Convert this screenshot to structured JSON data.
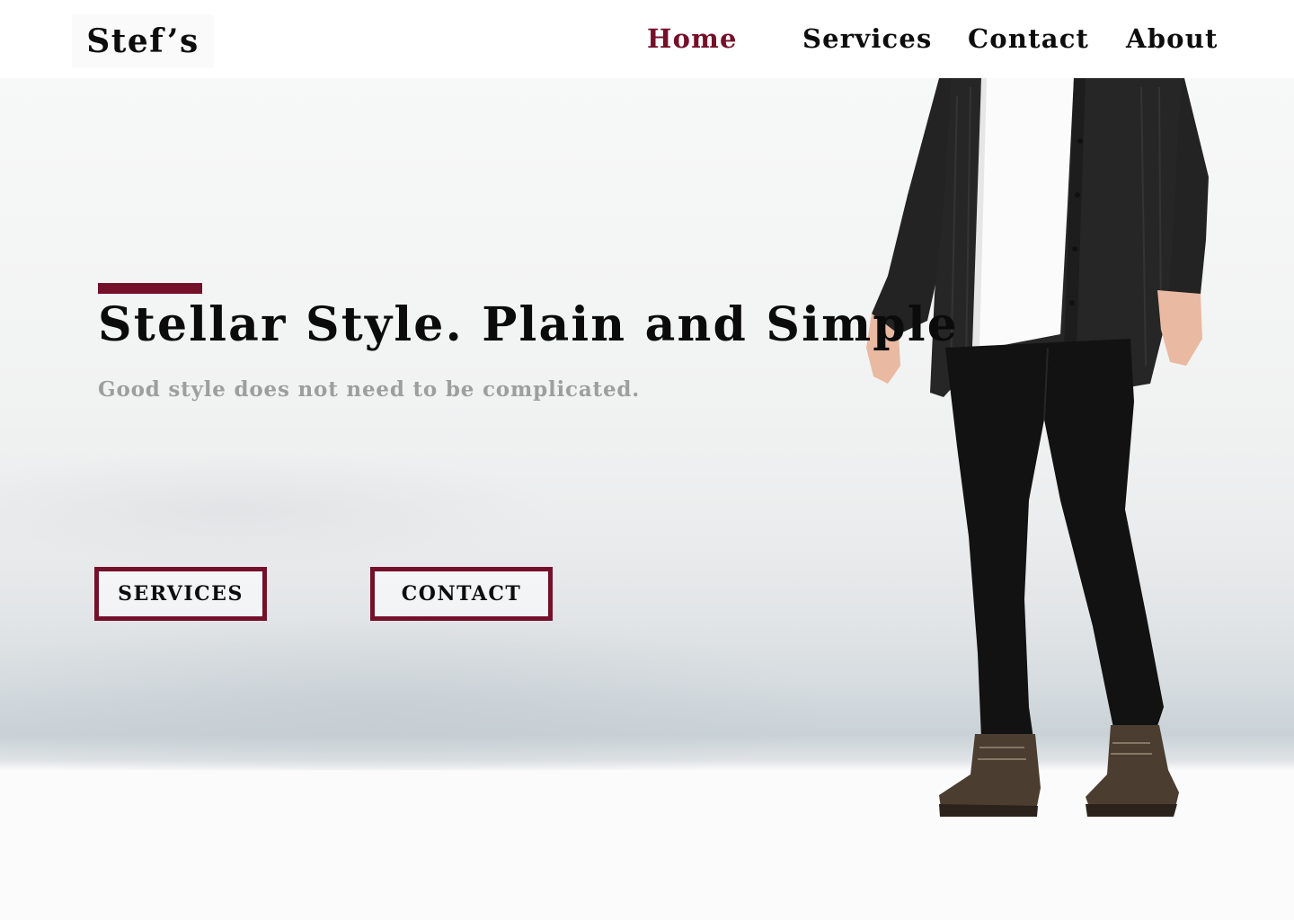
{
  "header": {
    "logo": "Stef’s",
    "nav": {
      "home": "Home",
      "services": "Services",
      "contact": "Contact",
      "about": "About"
    },
    "active_item": "Home"
  },
  "hero": {
    "title": "Stellar Style. Plain and Simple",
    "subtitle": "Good style does not need to be complicated.",
    "buttons": {
      "services": "SERVICES",
      "contact": "CONTACT"
    },
    "image_subject": "person in black cardigan, white t-shirt, black jeans and brown boots standing on snow"
  },
  "colors": {
    "accent": "#75102a",
    "text": "#0d0d0d",
    "subtitle": "#9e9e9e",
    "background": "#ffffff"
  }
}
